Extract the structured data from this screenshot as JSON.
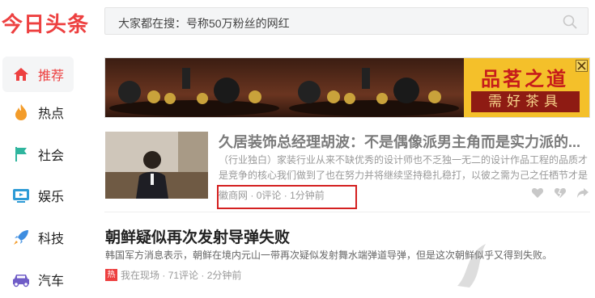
{
  "header": {
    "logo": "今日头条",
    "search_text": "大家都在搜：号称50万粉丝的网红"
  },
  "sidebar": {
    "items": [
      {
        "label": "推荐",
        "icon": "home-icon"
      },
      {
        "label": "热点",
        "icon": "flame-icon"
      },
      {
        "label": "社会",
        "icon": "flag-icon"
      },
      {
        "label": "娱乐",
        "icon": "tv-icon"
      },
      {
        "label": "科技",
        "icon": "rocket-icon"
      },
      {
        "label": "汽车",
        "icon": "car-icon"
      }
    ]
  },
  "ad": {
    "brand_title": "品茗之道",
    "brand_sub": "需好茶具"
  },
  "articles": [
    {
      "title": "久居装饰总经理胡波：不是偶像派男主角而是实力派的...",
      "abstract": "（行业独白）家装行业从来不缺优秀的设计师也不乏独一无二的设计作品工程的品质才是竞争的核心我们做到了也在努力并将继续坚持稳扎稳打，以彼之需为己之任栖节才是",
      "source": "徽商网",
      "comments": "0评论",
      "time": "1分钟前"
    },
    {
      "title": "朝鲜疑似再次发射导弹失败",
      "abstract": "韩国军方消息表示，朝鲜在境内元山一带再次疑似发射舞水端弹道导弹，但是这次朝鲜似乎又得到失败。",
      "badge": "热",
      "source": "我在现场",
      "comments": "71评论",
      "time": "2分钟前"
    }
  ],
  "colors": {
    "brand_red": "#ed4040",
    "highlight_box": "#d42020"
  }
}
